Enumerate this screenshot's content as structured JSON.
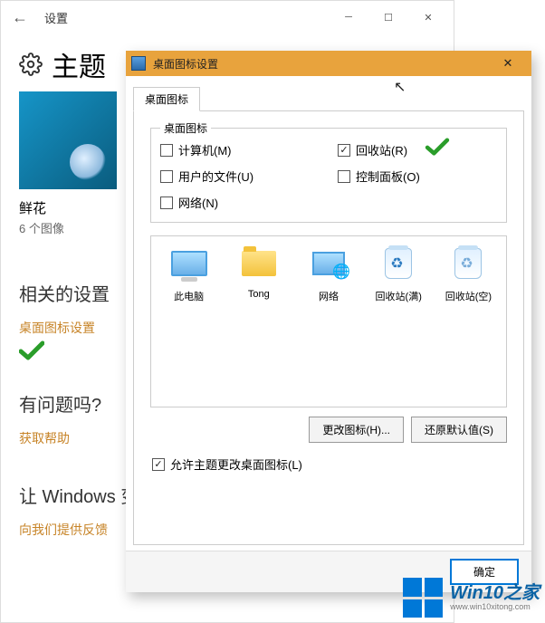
{
  "settings": {
    "title": "设置",
    "heading": "主题",
    "thumbnail_title": "鲜花",
    "thumbnail_subtitle": "6 个图像",
    "related_heading": "相关的设置",
    "desktop_icon_link": "桌面图标设置",
    "help_heading": "有问题吗?",
    "help_link": "获取帮助",
    "improve_heading": "让 Windows 变",
    "feedback_link": "向我们提供反馈"
  },
  "dialog": {
    "title": "桌面图标设置",
    "tab_label": "桌面图标",
    "group_label": "桌面图标",
    "checkboxes": {
      "computer": {
        "label": "计算机(M)",
        "checked": false
      },
      "recycle": {
        "label": "回收站(R)",
        "checked": true
      },
      "userfiles": {
        "label": "用户的文件(U)",
        "checked": false
      },
      "controlpanel": {
        "label": "控制面板(O)",
        "checked": false
      },
      "network": {
        "label": "网络(N)",
        "checked": false
      }
    },
    "icons": [
      {
        "name": "此电脑"
      },
      {
        "name": "Tong"
      },
      {
        "name": "网络"
      },
      {
        "name": "回收站(满)"
      },
      {
        "name": "回收站(空)"
      }
    ],
    "change_icon_btn": "更改图标(H)...",
    "restore_btn": "还原默认值(S)",
    "allow_themes": {
      "label": "允许主题更改桌面图标(L)",
      "checked": true
    },
    "ok_btn": "确定"
  },
  "watermark": {
    "brand": "Win10之家",
    "url": "www.win10xitong.com"
  }
}
